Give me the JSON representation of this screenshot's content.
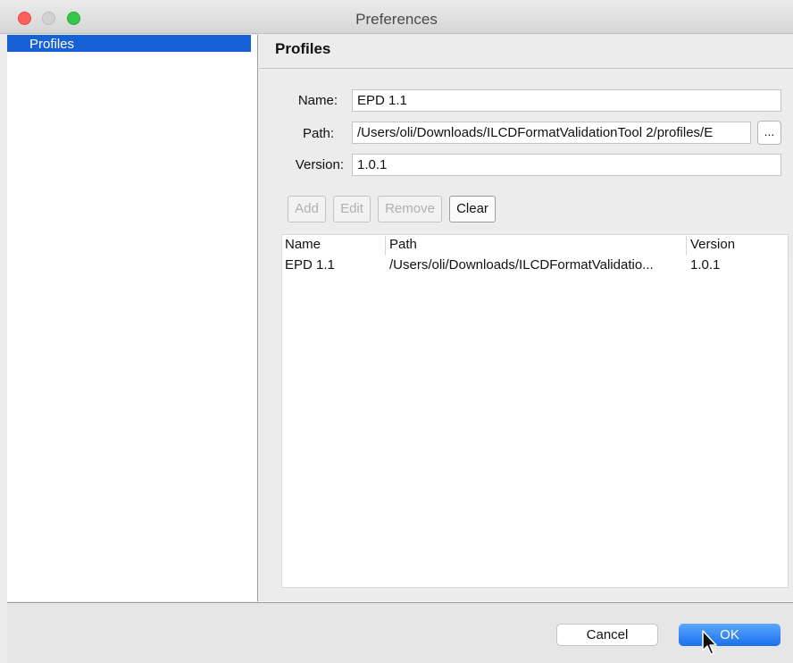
{
  "window": {
    "title": "Preferences"
  },
  "sidebar": {
    "items": [
      {
        "label": "Profiles",
        "selected": true
      }
    ]
  },
  "section": {
    "title": "Profiles"
  },
  "form": {
    "name_label": "Name:",
    "name_value": "EPD 1.1",
    "path_label": "Path:",
    "path_value": "/Users/oli/Downloads/ILCDFormatValidationTool 2/profiles/E",
    "browse_label": "...",
    "version_label": "Version:",
    "version_value": "1.0.1"
  },
  "buttons": {
    "add": "Add",
    "edit": "Edit",
    "remove": "Remove",
    "clear": "Clear"
  },
  "table": {
    "columns": [
      "Name",
      "Path",
      "Version"
    ],
    "rows": [
      {
        "name": "EPD 1.1",
        "path": "/Users/oli/Downloads/ILCDFormatValidatio...",
        "version": "1.0.1"
      }
    ]
  },
  "footer": {
    "cancel_label": "Cancel",
    "ok_label": "OK"
  },
  "colors": {
    "accent": "#1761d6",
    "ok_button": "#1b70ec",
    "close": "#fc605b",
    "maximize": "#34c84a"
  },
  "icons": [
    "close-icon",
    "minimize-icon",
    "maximize-icon",
    "mouse-pointer-icon"
  ]
}
